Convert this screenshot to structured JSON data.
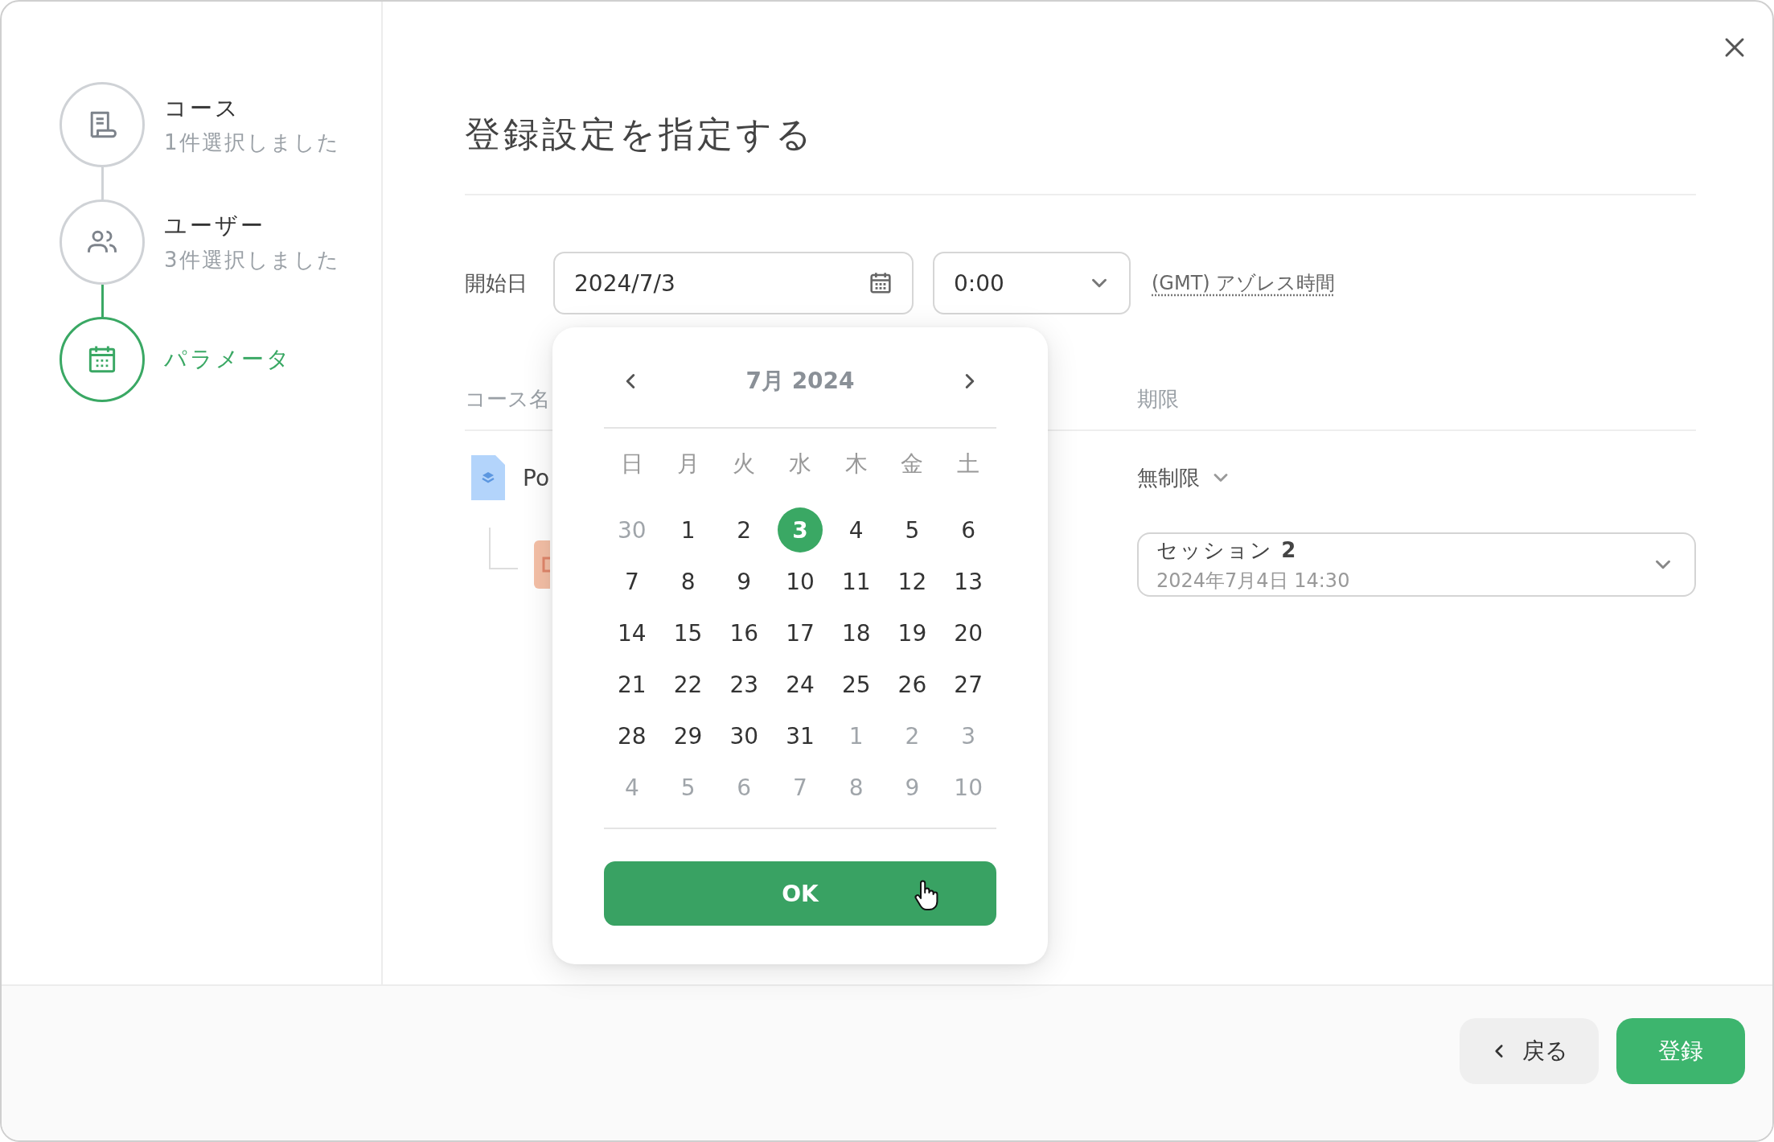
{
  "steps": [
    {
      "kind": "course",
      "title": "コース",
      "subtitle": "1件選択しました",
      "current": false
    },
    {
      "kind": "user",
      "title": "ユーザー",
      "subtitle": "3件選択しました",
      "current": false
    },
    {
      "kind": "parameter",
      "title": "パラメータ",
      "current": true
    }
  ],
  "title": "登録設定を指定する",
  "start": {
    "label": "開始日",
    "date": "2024/7/3",
    "time": "0:00",
    "timezone": "(GMT) アゾレス時間"
  },
  "table": {
    "columns": [
      {
        "label": "コース名"
      },
      {
        "label": "期限"
      }
    ],
    "rows": [
      {
        "kind": "course",
        "name": "Po",
        "deadline": "無制限"
      },
      {
        "kind": "session",
        "session_title": "セッション **2**",
        "session_date": "2024年7月4日 14:30"
      }
    ]
  },
  "calendar": {
    "month_label": "7月 2024",
    "weekdays": [
      "日",
      "月",
      "火",
      "水",
      "木",
      "金",
      "土"
    ],
    "days": [
      {
        "day": "30",
        "outside": true,
        "selected": false
      },
      {
        "day": "1",
        "outside": false,
        "selected": false
      },
      {
        "day": "2",
        "outside": false,
        "selected": false
      },
      {
        "day": "3",
        "outside": false,
        "selected": true
      },
      {
        "day": "4",
        "outside": false,
        "selected": false
      },
      {
        "day": "5",
        "outside": false,
        "selected": false
      },
      {
        "day": "6",
        "outside": false,
        "selected": false
      },
      {
        "day": "7",
        "outside": false,
        "selected": false
      },
      {
        "day": "8",
        "outside": false,
        "selected": false
      },
      {
        "day": "9",
        "outside": false,
        "selected": false
      },
      {
        "day": "10",
        "outside": false,
        "selected": false
      },
      {
        "day": "11",
        "outside": false,
        "selected": false
      },
      {
        "day": "12",
        "outside": false,
        "selected": false
      },
      {
        "day": "13",
        "outside": false,
        "selected": false
      },
      {
        "day": "14",
        "outside": false,
        "selected": false
      },
      {
        "day": "15",
        "outside": false,
        "selected": false
      },
      {
        "day": "16",
        "outside": false,
        "selected": false
      },
      {
        "day": "17",
        "outside": false,
        "selected": false
      },
      {
        "day": "18",
        "outside": false,
        "selected": false
      },
      {
        "day": "19",
        "outside": false,
        "selected": false
      },
      {
        "day": "20",
        "outside": false,
        "selected": false
      },
      {
        "day": "21",
        "outside": false,
        "selected": false
      },
      {
        "day": "22",
        "outside": false,
        "selected": false
      },
      {
        "day": "23",
        "outside": false,
        "selected": false
      },
      {
        "day": "24",
        "outside": false,
        "selected": false
      },
      {
        "day": "25",
        "outside": false,
        "selected": false
      },
      {
        "day": "26",
        "outside": false,
        "selected": false
      },
      {
        "day": "27",
        "outside": false,
        "selected": false
      },
      {
        "day": "28",
        "outside": false,
        "selected": false
      },
      {
        "day": "29",
        "outside": false,
        "selected": false
      },
      {
        "day": "30",
        "outside": false,
        "selected": false
      },
      {
        "day": "31",
        "outside": false,
        "selected": false
      },
      {
        "day": "1",
        "outside": true,
        "selected": false
      },
      {
        "day": "2",
        "outside": true,
        "selected": false
      },
      {
        "day": "3",
        "outside": true,
        "selected": false
      },
      {
        "day": "4",
        "outside": true,
        "selected": false
      },
      {
        "day": "5",
        "outside": true,
        "selected": false
      },
      {
        "day": "6",
        "outside": true,
        "selected": false
      },
      {
        "day": "7",
        "outside": true,
        "selected": false
      },
      {
        "day": "8",
        "outside": true,
        "selected": false
      },
      {
        "day": "9",
        "outside": true,
        "selected": false
      },
      {
        "day": "10",
        "outside": true,
        "selected": false
      }
    ],
    "ok": "OK"
  },
  "footer": {
    "back": "戻る",
    "submit": "登録"
  }
}
